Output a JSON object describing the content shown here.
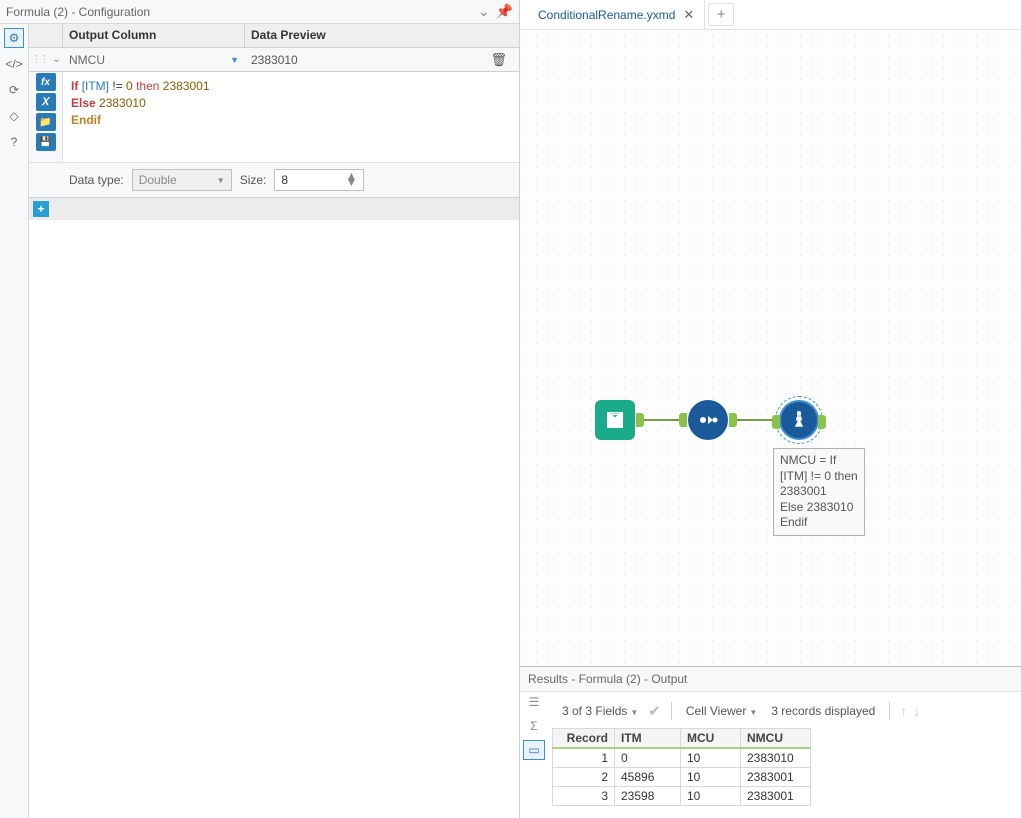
{
  "panel": {
    "title": "Formula (2) - Configuration",
    "columns": {
      "output": "Output Column",
      "preview": "Data Preview"
    },
    "row": {
      "field": "NMCU",
      "preview": "2383010"
    },
    "expr_lines": [
      "If [ITM] != 0 then 2383001",
      "Else 2383010",
      "Endif"
    ],
    "datatype": {
      "label": "Data type:",
      "value": "Double",
      "size_label": "Size:",
      "size_value": "8"
    }
  },
  "tab": {
    "name": "ConditionalRename.yxmd"
  },
  "tooltip": {
    "l1": "NMCU = If",
    "l2": "[ITM] != 0 then",
    "l3": "2383001",
    "l4": "Else 2383010",
    "l5": "Endif"
  },
  "results": {
    "title": "Results - Formula (2) - Output",
    "fields_label": "3 of 3 Fields",
    "viewer_label": "Cell Viewer",
    "records_label": "3 records displayed",
    "headers": {
      "rec": "Record",
      "itm": "ITM",
      "mcu": "MCU",
      "nmcu": "NMCU"
    },
    "rows": [
      {
        "rec": "1",
        "itm": "0",
        "mcu": "10",
        "nmcu": "2383010"
      },
      {
        "rec": "2",
        "itm": "45896",
        "mcu": "10",
        "nmcu": "2383001"
      },
      {
        "rec": "3",
        "itm": "23598",
        "mcu": "10",
        "nmcu": "2383001"
      }
    ]
  }
}
